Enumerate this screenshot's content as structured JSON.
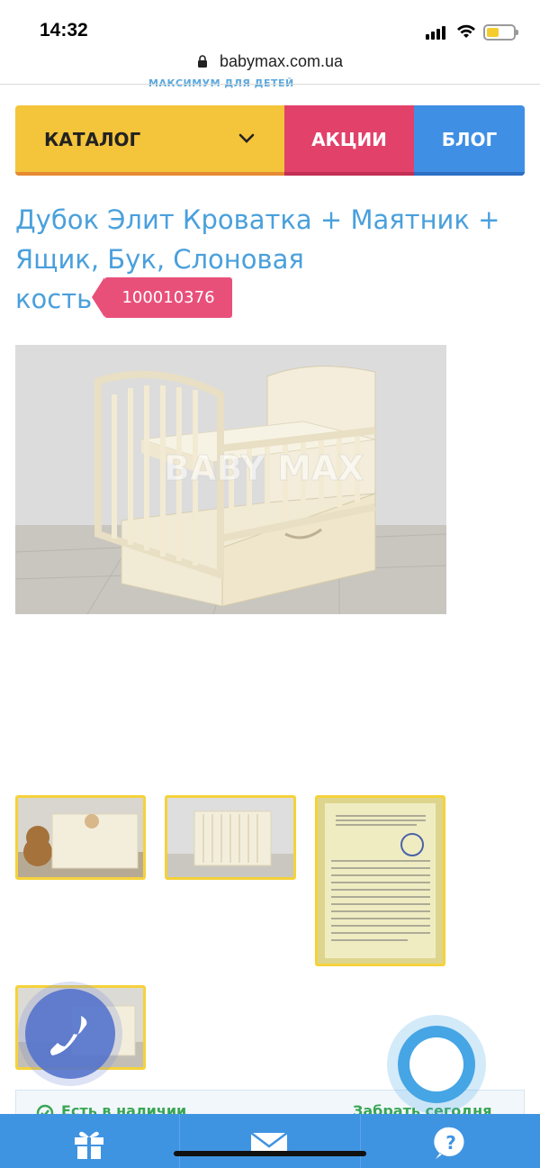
{
  "status": {
    "time": "14:32"
  },
  "browser": {
    "url": "babymax.com.ua"
  },
  "logo": {
    "tagline": "МАКСИМУМ ДЛЯ ДЕТЕЙ"
  },
  "nav": {
    "catalog": "КАТАЛОГ",
    "sales": "АКЦИИ",
    "blog": "БЛОГ"
  },
  "product": {
    "title_line1": "Дубок Элит Кроватка + Маятник +",
    "title_line2": "Ящик, Бук, Слоновая",
    "title_line3": "кость",
    "sku": "100010376",
    "photo_watermark": "BABY MAX"
  },
  "availability": {
    "status": "Есть в наличии",
    "pickup": "Забрать сегодня"
  },
  "bottom_nav": [
    "gift-icon",
    "mail-icon",
    "help-icon"
  ],
  "colors": {
    "accent_blue": "#3f94e2",
    "catalog_yellow": "#f4c43b",
    "sales_pink": "#e2416a",
    "blog_blue": "#3f8fe5",
    "title_blue": "#4aa0dc",
    "sku_pink": "#e8507a"
  }
}
